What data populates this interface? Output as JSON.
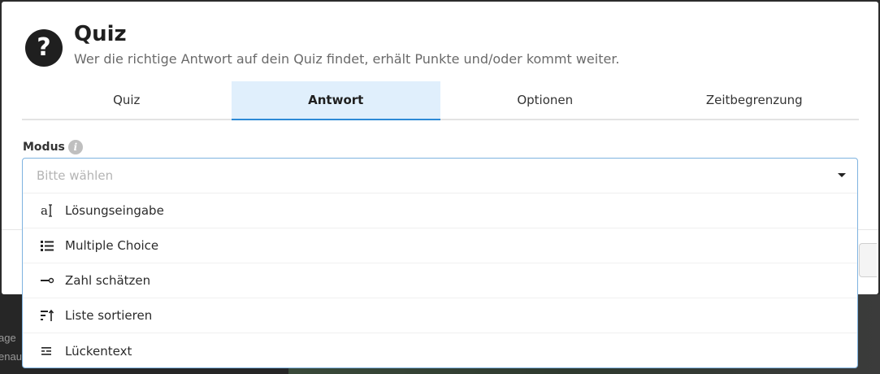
{
  "modal": {
    "title": "Quiz",
    "subtitle": "Wer die richtige Antwort auf dein Quiz findet, erhält Punkte und/oder kommt weiter.",
    "header_icon": "question-mark-icon"
  },
  "tabs": [
    {
      "label": "Quiz",
      "active": false
    },
    {
      "label": "Antwort",
      "active": true
    },
    {
      "label": "Optionen",
      "active": false
    },
    {
      "label": "Zeitbegrenzung",
      "active": false
    }
  ],
  "mode_field": {
    "label": "Modus",
    "placeholder": "Bitte wählen",
    "options": [
      {
        "label": "Lösungseingabe",
        "icon": "text-input-icon"
      },
      {
        "label": "Multiple Choice",
        "icon": "list-icon"
      },
      {
        "label": "Zahl schätzen",
        "icon": "slider-icon"
      },
      {
        "label": "Liste sortieren",
        "icon": "sort-list-icon"
      },
      {
        "label": "Lückentext",
        "icon": "gap-text-icon"
      }
    ]
  },
  "background": {
    "text_line_1": "age",
    "text_line_2": "enau"
  },
  "colors": {
    "active_tab_bg": "#e0effc",
    "active_tab_underline": "#2d8ad6",
    "select_border": "#7fb3e0"
  }
}
